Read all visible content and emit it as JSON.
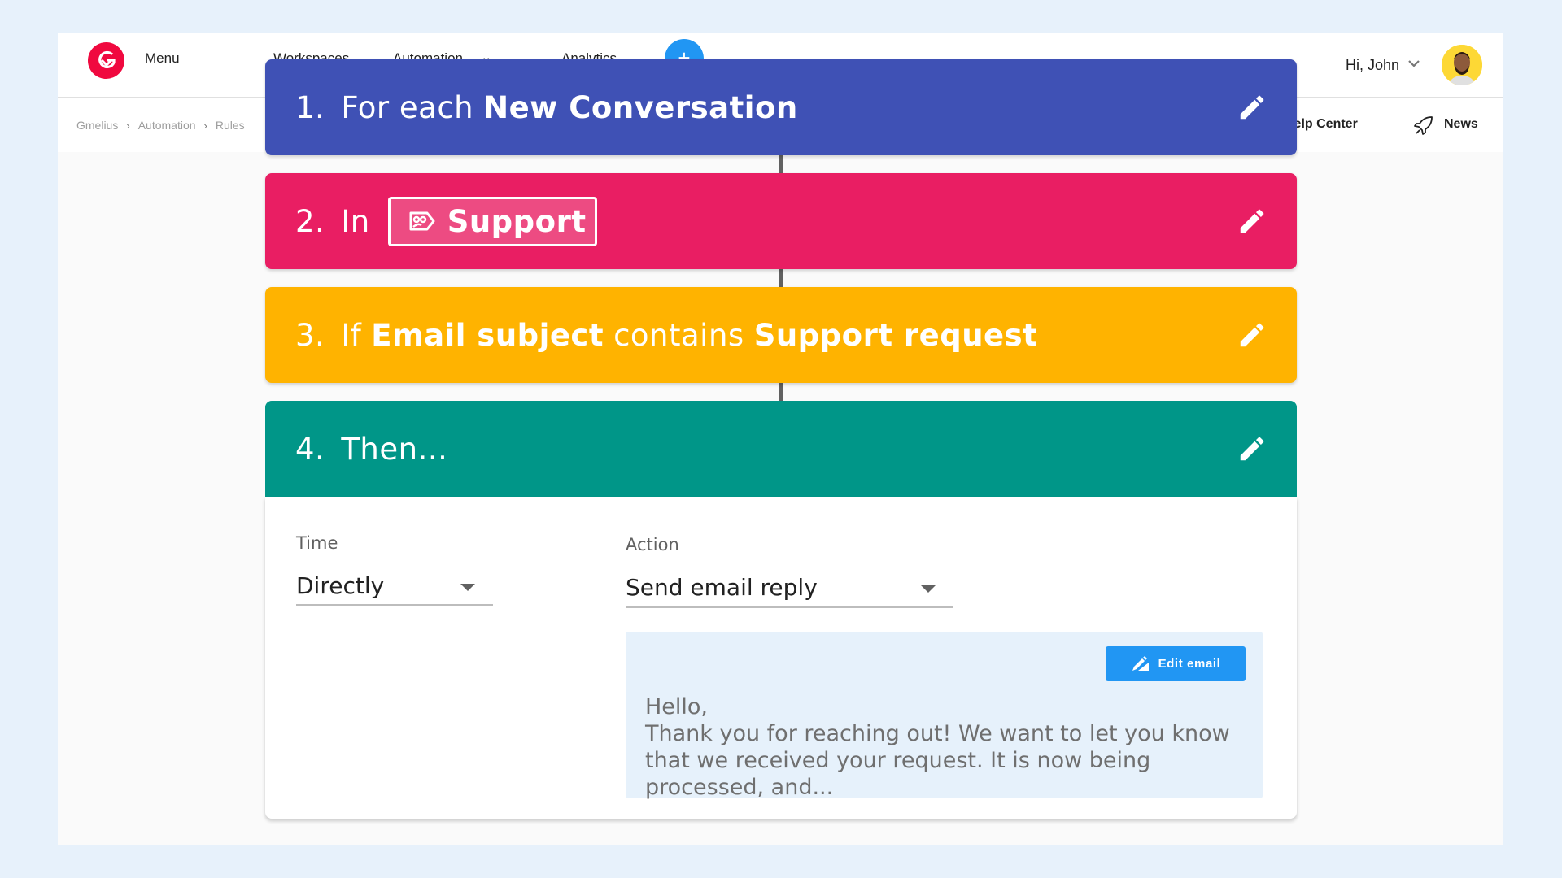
{
  "nav": {
    "menu": "Menu",
    "workspaces": "Workspaces",
    "automation": "Automation",
    "analytics": "Analytics",
    "add": "+",
    "greeting": "Hi, John"
  },
  "breadcrumb": [
    "Gmelius",
    "Automation",
    "Rules"
  ],
  "subnav": {
    "help": "Help Center",
    "news": "News"
  },
  "steps": [
    {
      "num": "1.",
      "pre": "For each",
      "bold": "New Conversation",
      "color": "#3f51b5"
    },
    {
      "num": "2.",
      "pre": "In",
      "tag": "Support",
      "color": "#e91e63"
    },
    {
      "num": "3.",
      "pre": "If",
      "bold1": "Email subject",
      "mid": "contains",
      "bold2": "Support request",
      "color": "#ffb300"
    },
    {
      "num": "4.",
      "pre": "Then...",
      "color": "#009688"
    }
  ],
  "config": {
    "time_label": "Time",
    "time_value": "Directly",
    "action_label": "Action",
    "action_value": "Send email reply",
    "edit_button": "Edit email",
    "email_line1": "Hello,",
    "email_line2": "Thank you for reaching out! We want to let you know that we received your request. It is now being processed, and..."
  }
}
